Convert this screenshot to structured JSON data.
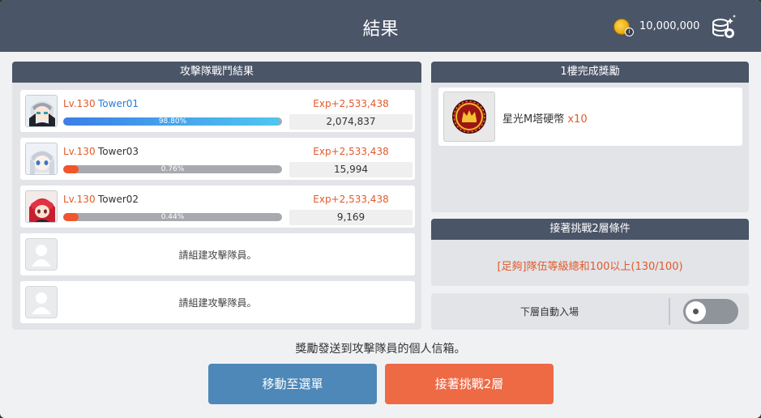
{
  "window": {
    "title": "結果"
  },
  "currency": {
    "amount": "10,000,000",
    "icon": "gold-coin-icon",
    "badge": "i"
  },
  "battle": {
    "header": "攻擊隊戰鬥結果",
    "members": [
      {
        "level": "Lv.130",
        "name": "Tower01",
        "exp": "Exp+2,533,438",
        "percent_label": "98.80%",
        "percent": 98.8,
        "damage": "2,074,837",
        "name_color": "#2a7bd8"
      },
      {
        "level": "Lv.130",
        "name": "Tower03",
        "exp": "Exp+2,533,438",
        "percent_label": "0.76%",
        "percent": 0.76,
        "damage": "15,994",
        "name_color": "#333333"
      },
      {
        "level": "Lv.130",
        "name": "Tower02",
        "exp": "Exp+2,533,438",
        "percent_label": "0.44%",
        "percent": 0.44,
        "damage": "9,169",
        "name_color": "#333333"
      }
    ],
    "empty_slots": [
      {
        "text": "請組建攻擊隊員。"
      },
      {
        "text": "請組建攻擊隊員。"
      }
    ]
  },
  "reward": {
    "header": "1樓完成獎勵",
    "item_name": "星光M塔硬幣",
    "item_qty": "x10",
    "item_icon": "tower-coin-icon"
  },
  "condition": {
    "header": "接著挑戰2層條件",
    "text": "[足夠]隊伍等級總和100以上(130/100)"
  },
  "auto_enter": {
    "label": "下層自動入場",
    "enabled": false
  },
  "notice": "獎勵發送到攻擊隊員的個人信箱。",
  "buttons": {
    "menu": "移動至選單",
    "next": "接著挑戰2層"
  },
  "colors": {
    "header_bg": "#4b5568",
    "accent_orange": "#e25a2b",
    "button_blue": "#4e88b8",
    "button_orange": "#ee6a45"
  }
}
